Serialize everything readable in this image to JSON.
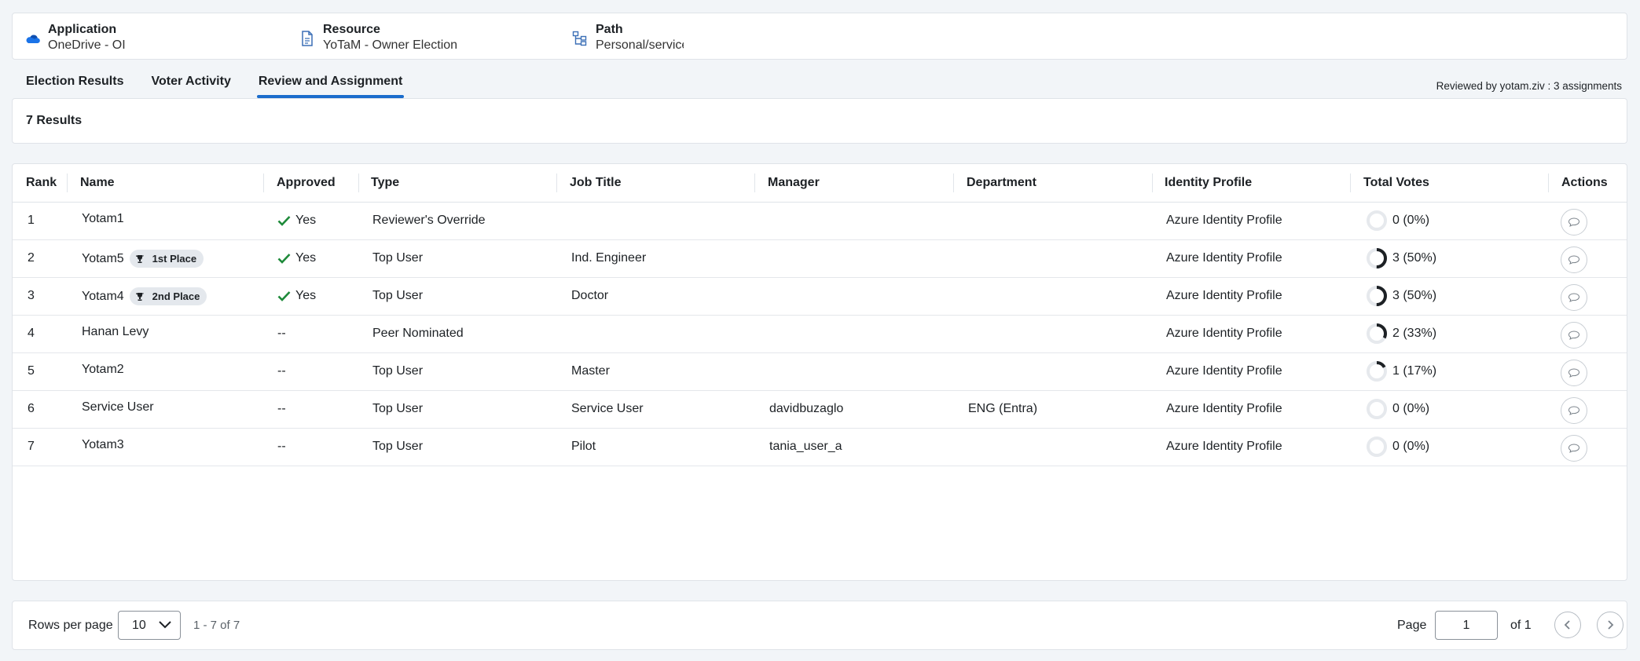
{
  "header": {
    "application": {
      "label": "Application",
      "value": "OneDrive - OI"
    },
    "resource": {
      "label": "Resource",
      "value": "YoTaM - Owner Election"
    },
    "path": {
      "label": "Path",
      "value": "Personal/service/"
    }
  },
  "tabs": [
    {
      "label": "Election Results",
      "active": false
    },
    {
      "label": "Voter Activity",
      "active": false
    },
    {
      "label": "Review and Assignment",
      "active": true
    }
  ],
  "reviewed_by": "Reviewed by yotam.ziv : 3 assignments",
  "results_count": "7 Results",
  "table": {
    "columns": [
      "Rank",
      "Name",
      "Approved",
      "Type",
      "Job Title",
      "Manager",
      "Department",
      "Identity Profile",
      "Total Votes",
      "Actions"
    ],
    "rows": [
      {
        "rank": "1",
        "name": "Yotam1",
        "badge": "",
        "approved": "Yes",
        "approved_check": true,
        "type": "Reviewer's Override",
        "job_title": "",
        "manager": "",
        "department": "",
        "identity_profile": "Azure Identity Profile",
        "votes": "0 (0%)",
        "vote_fraction": 0
      },
      {
        "rank": "2",
        "name": "Yotam5",
        "badge": "1st Place",
        "approved": "Yes",
        "approved_check": true,
        "type": "Top User",
        "job_title": "Ind. Engineer",
        "manager": "",
        "department": "",
        "identity_profile": "Azure Identity Profile",
        "votes": "3 (50%)",
        "vote_fraction": 0.5
      },
      {
        "rank": "3",
        "name": "Yotam4",
        "badge": "2nd Place",
        "approved": "Yes",
        "approved_check": true,
        "type": "Top User",
        "job_title": "Doctor",
        "manager": "",
        "department": "",
        "identity_profile": "Azure Identity Profile",
        "votes": "3 (50%)",
        "vote_fraction": 0.5
      },
      {
        "rank": "4",
        "name": "Hanan Levy",
        "badge": "",
        "approved": "--",
        "approved_check": false,
        "type": "Peer Nominated",
        "job_title": "",
        "manager": "",
        "department": "",
        "identity_profile": "Azure Identity Profile",
        "votes": "2 (33%)",
        "vote_fraction": 0.33
      },
      {
        "rank": "5",
        "name": "Yotam2",
        "badge": "",
        "approved": "--",
        "approved_check": false,
        "type": "Top User",
        "job_title": "Master",
        "manager": "",
        "department": "",
        "identity_profile": "Azure Identity Profile",
        "votes": "1 (17%)",
        "vote_fraction": 0.17
      },
      {
        "rank": "6",
        "name": "Service User",
        "badge": "",
        "approved": "--",
        "approved_check": false,
        "type": "Top User",
        "job_title": "Service User",
        "manager": "davidbuzaglo",
        "department": "ENG (Entra)",
        "identity_profile": "Azure Identity Profile",
        "votes": "0 (0%)",
        "vote_fraction": 0
      },
      {
        "rank": "7",
        "name": "Yotam3",
        "badge": "",
        "approved": "--",
        "approved_check": false,
        "type": "Top User",
        "job_title": "Pilot",
        "manager": "tania_user_a",
        "department": "",
        "identity_profile": "Azure Identity Profile",
        "votes": "0 (0%)",
        "vote_fraction": 0
      }
    ]
  },
  "pagination": {
    "rows_per_page_label": "Rows per page",
    "rows_per_page": "10",
    "range": "1 - 7 of 7",
    "page_label": "Page",
    "page": "1",
    "of_label": "of 1"
  },
  "colors": {
    "accent": "#1a6ccc",
    "check": "#1e8a3a",
    "ring_fill": "#1d2125",
    "ring_track": "#e6e9ed"
  }
}
